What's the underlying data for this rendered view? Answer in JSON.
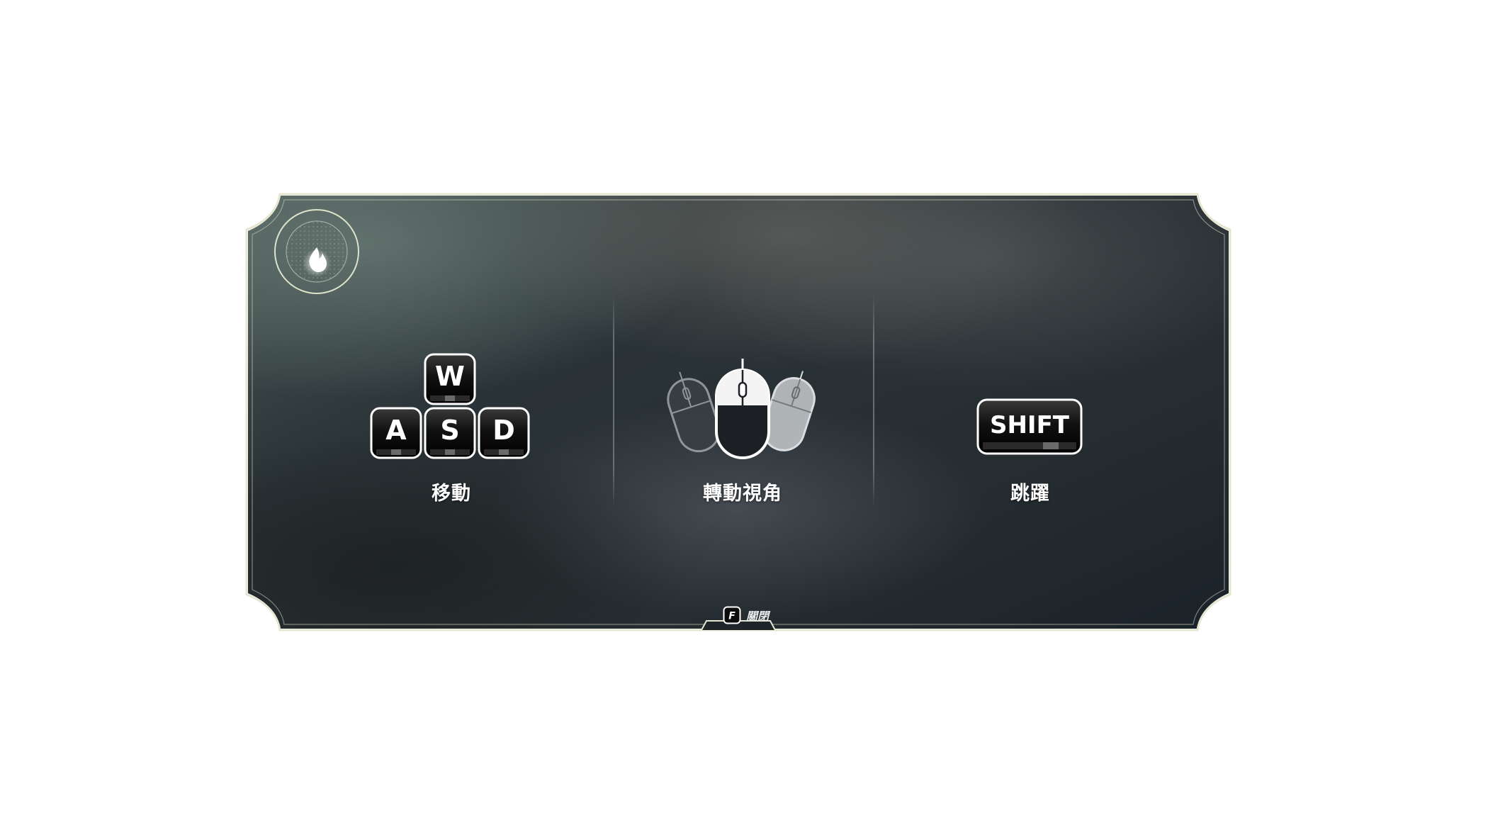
{
  "controls": [
    {
      "id": "move",
      "keys": [
        "W",
        "A",
        "S",
        "D"
      ],
      "label": "移動"
    },
    {
      "id": "look",
      "device": "mouse",
      "label": "轉動視角"
    },
    {
      "id": "jump",
      "keys": [
        "SHIFT"
      ],
      "label": "跳躍"
    }
  ],
  "close_hint": {
    "key": "F",
    "label": "關閉"
  },
  "badge": {
    "icon": "fire-icon"
  },
  "colors": {
    "frame": "#e4e6cf",
    "panel_dark": "#1d2326",
    "key_fill": "#0a0a0a",
    "key_border": "#ffffff",
    "text": "#ffffff"
  }
}
